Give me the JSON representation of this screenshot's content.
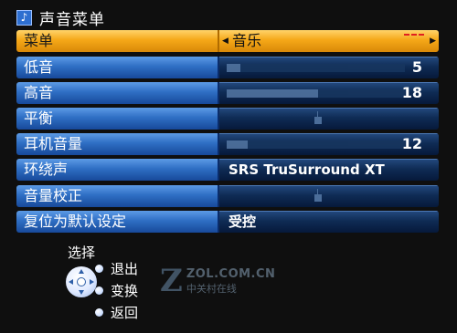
{
  "window": {
    "title": "声音菜单",
    "title_icon": "music-note-icon"
  },
  "menu": {
    "rows": [
      {
        "label": "菜单",
        "value": "音乐",
        "selected": true
      },
      {
        "label": "低音",
        "value": "5",
        "level": 5,
        "level_max": 64
      },
      {
        "label": "高音",
        "value": "18",
        "level": 18,
        "level_max": 35
      },
      {
        "label": "平衡",
        "value": ""
      },
      {
        "label": "耳机音量",
        "value": "12",
        "level": 12,
        "level_max": 100
      },
      {
        "label": "环绕声",
        "value": "SRS TruSurround XT"
      },
      {
        "label": "音量校正",
        "value": ""
      },
      {
        "label": "复位为默认设定",
        "value": "受控"
      }
    ]
  },
  "legend": {
    "title": "选择",
    "items": [
      {
        "label": "退出",
        "icon": "exit-button-dot"
      },
      {
        "label": "变换",
        "icon": "change-button-dot"
      },
      {
        "label": "返回",
        "icon": "return-button-dot"
      }
    ]
  },
  "watermark": {
    "logo": "Z",
    "line1": "ZOL.COM.CN",
    "line2": "中关村在线"
  },
  "colors": {
    "accent_selected": "#f5a818",
    "row_blue": "#2f6fc4",
    "background": "#0f0f0f"
  }
}
